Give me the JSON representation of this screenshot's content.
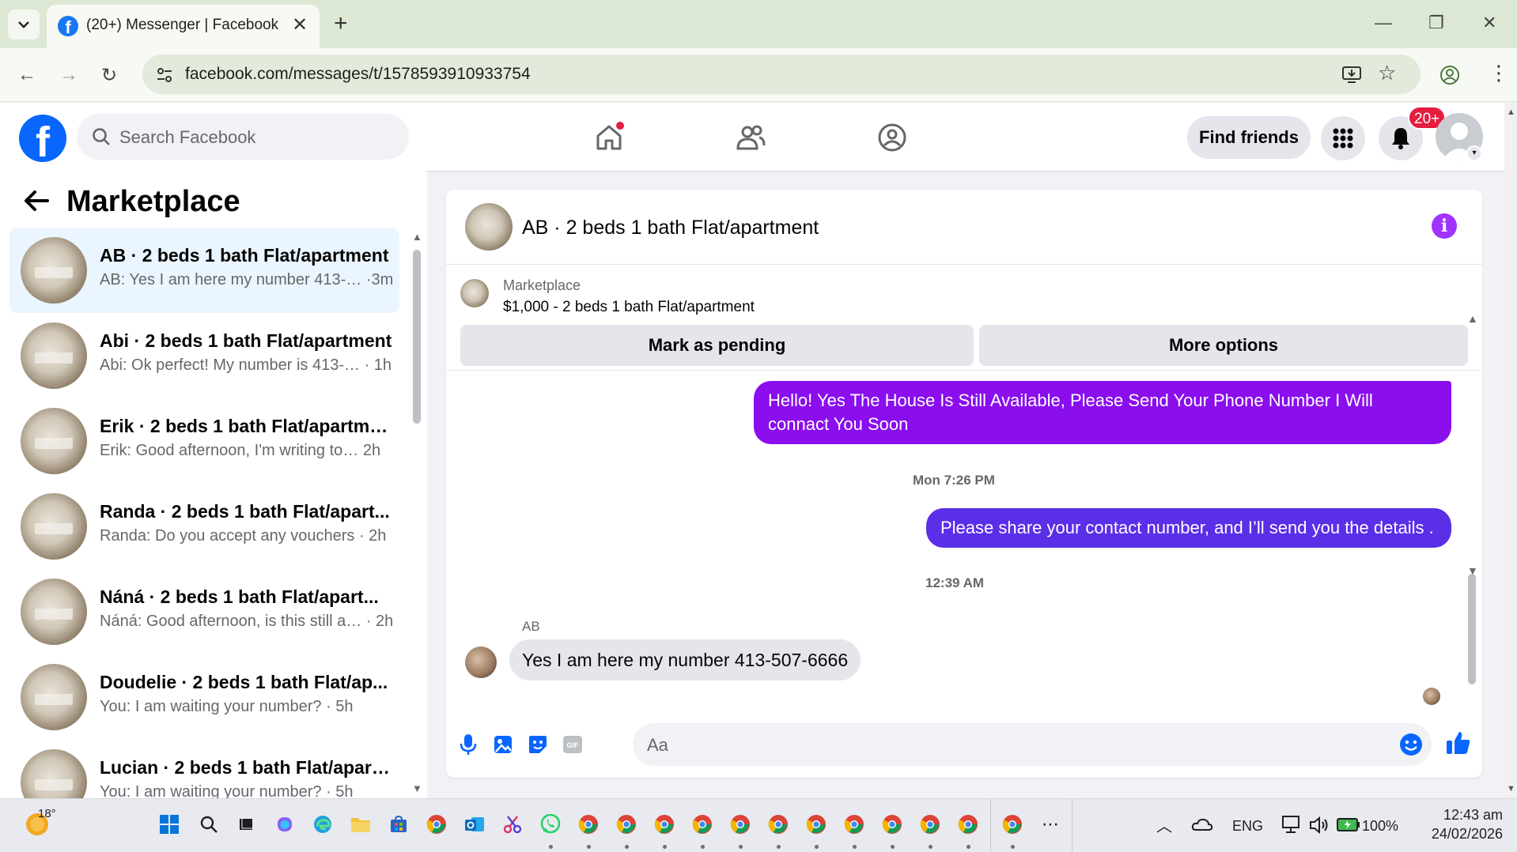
{
  "browser": {
    "tab_title": "(20+) Messenger | Facebook",
    "url": "facebook.com/messages/t/1578593910933754"
  },
  "fb_header": {
    "search_placeholder": "Search Facebook",
    "find_friends_label": "Find friends",
    "notification_count": "20+"
  },
  "sidebar": {
    "title": "Marketplace",
    "conversations": [
      {
        "name": "AB · 2 beds 1 bath Flat/apartment",
        "preview": "AB: Yes I am here my number 413-… ·3m",
        "active": true
      },
      {
        "name": "Abi · 2 beds 1 bath Flat/apartment",
        "preview": "Abi: Ok perfect! My number is 413-… · 1h"
      },
      {
        "name": "Erik · 2 beds 1 bath Flat/apartme...",
        "preview": "Erik: Good afternoon, I'm writing to…  2h"
      },
      {
        "name": "Randa · 2 beds 1 bath Flat/apart...",
        "preview": "Randa: Do you accept any vouchers · 2h"
      },
      {
        "name": "Náná · 2 beds 1 bath Flat/apart...",
        "preview": "Náná: Good afternoon, is this still a… · 2h"
      },
      {
        "name": "Doudelie · 2 beds 1 bath Flat/ap...",
        "preview": "You: I am waiting your number? · 5h"
      },
      {
        "name": "Lucian · 2 beds 1 bath Flat/apart...",
        "preview": "You: I am waiting your number? · 5h"
      }
    ]
  },
  "chat": {
    "title": "AB · 2 beds 1 bath Flat/apartment",
    "listing_label": "Marketplace",
    "listing_detail": "$1,000 - 2 beds 1 bath Flat/apartment",
    "mark_pending_label": "Mark as pending",
    "more_options_label": "More options",
    "messages": [
      {
        "from": "me",
        "text": "Hello! Yes The House  Is Still Available, Please Send Your Phone Number I Will connact You Soon"
      },
      {
        "type": "timestamp",
        "text": "Mon 7:26 PM"
      },
      {
        "from": "me",
        "text": "Please share your contact number, and I’ll send you the details ."
      },
      {
        "type": "timestamp",
        "text": "12:39 AM"
      },
      {
        "from": "AB",
        "sender_label": "AB",
        "text": "Yes I am here my number 413-507-6666"
      }
    ],
    "composer_placeholder": "Aa"
  },
  "taskbar": {
    "temperature": "18°",
    "language": "ENG",
    "battery": "100%",
    "time": "12:43 am",
    "date": "24/02/2026"
  },
  "colors": {
    "fb_blue": "#0866ff",
    "outgoing_bubble_1": "#8a0eee",
    "outgoing_bubble_2": "#5b2ee8",
    "accent_purple": "#a033ff",
    "notification_red": "#e41e3f"
  }
}
